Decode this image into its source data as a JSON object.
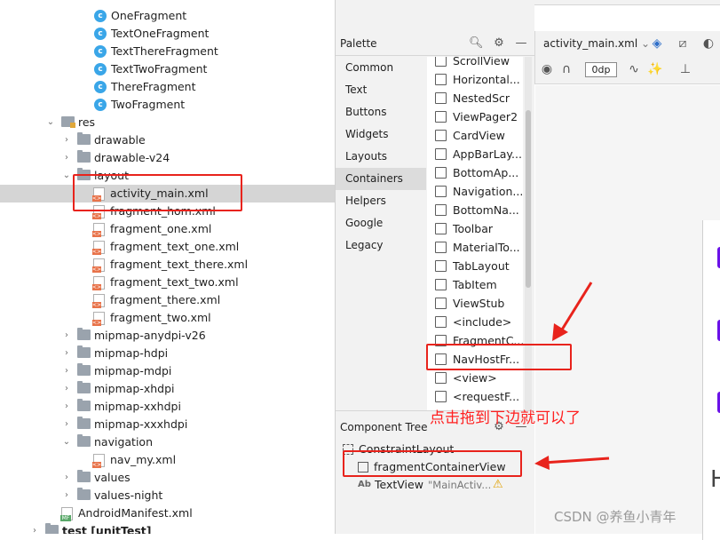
{
  "project_tree": {
    "items": [
      {
        "label": "OneFragment",
        "icon": "class-icon"
      },
      {
        "label": "TextOneFragment",
        "icon": "class-icon"
      },
      {
        "label": "TextThereFragment",
        "icon": "class-icon"
      },
      {
        "label": "TextTwoFragment",
        "icon": "class-icon"
      },
      {
        "label": "ThereFragment",
        "icon": "class-icon"
      },
      {
        "label": "TwoFragment",
        "icon": "class-icon"
      },
      {
        "label": "res",
        "icon": "res-folder-icon"
      },
      {
        "label": "drawable",
        "icon": "folder-icon"
      },
      {
        "label": "drawable-v24",
        "icon": "folder-icon"
      },
      {
        "label": "layout",
        "icon": "folder-icon"
      },
      {
        "label": "activity_main.xml",
        "icon": "xml-file-icon"
      },
      {
        "label": "fragment_hom.xml",
        "icon": "xml-file-icon"
      },
      {
        "label": "fragment_one.xml",
        "icon": "xml-file-icon"
      },
      {
        "label": "fragment_text_one.xml",
        "icon": "xml-file-icon"
      },
      {
        "label": "fragment_text_there.xml",
        "icon": "xml-file-icon"
      },
      {
        "label": "fragment_text_two.xml",
        "icon": "xml-file-icon"
      },
      {
        "label": "fragment_there.xml",
        "icon": "xml-file-icon"
      },
      {
        "label": "fragment_two.xml",
        "icon": "xml-file-icon"
      },
      {
        "label": "mipmap-anydpi-v26",
        "icon": "folder-icon"
      },
      {
        "label": "mipmap-hdpi",
        "icon": "folder-icon"
      },
      {
        "label": "mipmap-mdpi",
        "icon": "folder-icon"
      },
      {
        "label": "mipmap-xhdpi",
        "icon": "folder-icon"
      },
      {
        "label": "mipmap-xxhdpi",
        "icon": "folder-icon"
      },
      {
        "label": "mipmap-xxxhdpi",
        "icon": "folder-icon"
      },
      {
        "label": "navigation",
        "icon": "folder-icon"
      },
      {
        "label": "nav_my.xml",
        "icon": "xml-file-icon"
      },
      {
        "label": "values",
        "icon": "folder-icon"
      },
      {
        "label": "values-night",
        "icon": "folder-icon"
      },
      {
        "label": "AndroidManifest.xml",
        "icon": "manifest-file-icon"
      },
      {
        "label": "test [unitTest]",
        "icon": "folder-icon"
      }
    ],
    "selected": "activity_main.xml"
  },
  "palette": {
    "title": "Palette",
    "categories": [
      "Common",
      "Text",
      "Buttons",
      "Widgets",
      "Layouts",
      "Containers",
      "Helpers",
      "Google",
      "Legacy"
    ],
    "active_category": "Containers",
    "widgets": [
      "ScrollView",
      "Horizontal...",
      "NestedScr",
      "ViewPager2",
      "CardView",
      "AppBarLay...",
      "BottomAp...",
      "Navigation...",
      "BottomNa...",
      "Toolbar",
      "MaterialTo...",
      "TabLayout",
      "TabItem",
      "ViewStub",
      "<include>",
      "FragmentC...",
      "NavHostFr...",
      "<view>",
      "<requestF..."
    ]
  },
  "component_tree": {
    "title": "Component Tree",
    "items": [
      {
        "label": "ConstraintLayout"
      },
      {
        "label": "fragmentContainerView"
      },
      {
        "label": "TextView",
        "value": "\"MainActiv..."
      }
    ]
  },
  "design_toolbar": {
    "file_name": "activity_main.xml",
    "margin_value": "0dp"
  },
  "annotation": {
    "text": "点击拖到下边就可以了",
    "color": "#ff2020"
  },
  "watermark": "CSDN @养鱼小青年",
  "colors": {
    "accent_purple": "#6a11e8",
    "annotation_red": "#e8231c"
  }
}
